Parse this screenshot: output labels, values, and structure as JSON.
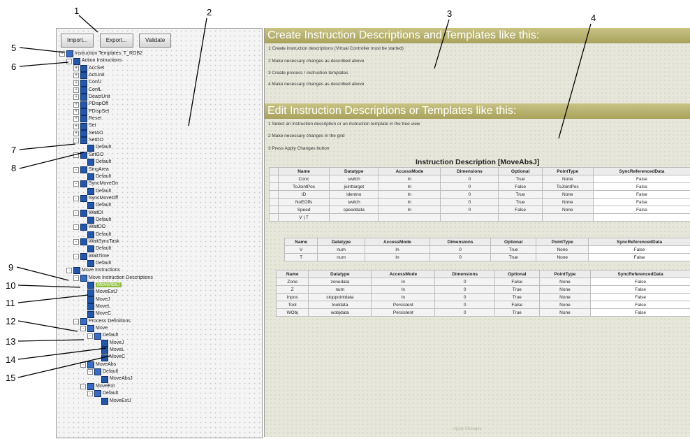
{
  "callouts": [
    "1",
    "2",
    "3",
    "4",
    "5",
    "6",
    "7",
    "8",
    "9",
    "10",
    "11",
    "12",
    "13",
    "14",
    "15"
  ],
  "toolbar": {
    "import_label": "Import...",
    "export_label": "Export...",
    "validate_label": "Validate"
  },
  "tree": [
    {
      "label": "Instruction Templates: T_ROB2",
      "indent": 0,
      "icon": "folder",
      "exp": "-"
    },
    {
      "label": "Action Instructions",
      "indent": 1,
      "icon": "group",
      "exp": "-"
    },
    {
      "label": "AccSet",
      "indent": 2,
      "icon": "instr",
      "exp": "+"
    },
    {
      "label": "ActUnit",
      "indent": 2,
      "icon": "instr",
      "exp": "+"
    },
    {
      "label": "ConfJ",
      "indent": 2,
      "icon": "instr",
      "exp": "+"
    },
    {
      "label": "ConfL",
      "indent": 2,
      "icon": "instr",
      "exp": "+"
    },
    {
      "label": "DeactUnit",
      "indent": 2,
      "icon": "instr",
      "exp": "+"
    },
    {
      "label": "PDispOff",
      "indent": 2,
      "icon": "instr",
      "exp": "+"
    },
    {
      "label": "PDispSet",
      "indent": 2,
      "icon": "instr",
      "exp": "+"
    },
    {
      "label": "Reset",
      "indent": 2,
      "icon": "instr",
      "exp": "+"
    },
    {
      "label": "Set",
      "indent": 2,
      "icon": "instr",
      "exp": "+"
    },
    {
      "label": "SetAO",
      "indent": 2,
      "icon": "instr",
      "exp": "+"
    },
    {
      "label": "SetDO",
      "indent": 2,
      "icon": "instr",
      "exp": "-"
    },
    {
      "label": "Default",
      "indent": 3,
      "icon": "instr",
      "exp": ""
    },
    {
      "label": "SetGO",
      "indent": 2,
      "icon": "instr",
      "exp": "-"
    },
    {
      "label": "Default",
      "indent": 3,
      "icon": "instr",
      "exp": ""
    },
    {
      "label": "SingArea",
      "indent": 2,
      "icon": "instr",
      "exp": "-"
    },
    {
      "label": "Default",
      "indent": 3,
      "icon": "instr",
      "exp": ""
    },
    {
      "label": "SyncMoveOn",
      "indent": 2,
      "icon": "instr",
      "exp": "-"
    },
    {
      "label": "Default",
      "indent": 3,
      "icon": "instr",
      "exp": ""
    },
    {
      "label": "SyncMoveOff",
      "indent": 2,
      "icon": "instr",
      "exp": "-"
    },
    {
      "label": "Default",
      "indent": 3,
      "icon": "instr",
      "exp": ""
    },
    {
      "label": "WaitDI",
      "indent": 2,
      "icon": "instr",
      "exp": "-"
    },
    {
      "label": "Default",
      "indent": 3,
      "icon": "instr",
      "exp": ""
    },
    {
      "label": "WaitDO",
      "indent": 2,
      "icon": "instr",
      "exp": "-"
    },
    {
      "label": "Default",
      "indent": 3,
      "icon": "instr",
      "exp": ""
    },
    {
      "label": "WaitSyncTask",
      "indent": 2,
      "icon": "instr",
      "exp": "-"
    },
    {
      "label": "Default",
      "indent": 3,
      "icon": "instr",
      "exp": ""
    },
    {
      "label": "WaitTime",
      "indent": 2,
      "icon": "instr",
      "exp": "-"
    },
    {
      "label": "Default",
      "indent": 3,
      "icon": "instr",
      "exp": ""
    },
    {
      "label": "Move Instructions",
      "indent": 1,
      "icon": "group",
      "exp": "-"
    },
    {
      "label": "Move Instruction Descriptions",
      "indent": 2,
      "icon": "folder",
      "exp": "-"
    },
    {
      "label": "MoveAbsJ",
      "indent": 3,
      "icon": "instr",
      "exp": "",
      "selected": true
    },
    {
      "label": "MoveExtJ",
      "indent": 3,
      "icon": "instr",
      "exp": ""
    },
    {
      "label": "MoveJ",
      "indent": 3,
      "icon": "instr",
      "exp": ""
    },
    {
      "label": "MoveL",
      "indent": 3,
      "icon": "instr",
      "exp": ""
    },
    {
      "label": "MoveC",
      "indent": 3,
      "icon": "instr",
      "exp": ""
    },
    {
      "label": "Process Definitions",
      "indent": 2,
      "icon": "folder",
      "exp": "-"
    },
    {
      "label": "Move",
      "indent": 3,
      "icon": "folder",
      "exp": "-"
    },
    {
      "label": "Default",
      "indent": 4,
      "icon": "folder",
      "exp": "-"
    },
    {
      "label": "MoveJ",
      "indent": 5,
      "icon": "instr",
      "exp": ""
    },
    {
      "label": "MoveL",
      "indent": 5,
      "icon": "instr",
      "exp": ""
    },
    {
      "label": "MoveC",
      "indent": 5,
      "icon": "instr",
      "exp": ""
    },
    {
      "label": "MoveAbs",
      "indent": 3,
      "icon": "folder",
      "exp": "-"
    },
    {
      "label": "Default",
      "indent": 4,
      "icon": "folder",
      "exp": "-"
    },
    {
      "label": "MoveAbsJ",
      "indent": 5,
      "icon": "instr",
      "exp": ""
    },
    {
      "label": "MoveExt",
      "indent": 3,
      "icon": "folder",
      "exp": "-"
    },
    {
      "label": "Default",
      "indent": 4,
      "icon": "folder",
      "exp": "-"
    },
    {
      "label": "MoveExtJ",
      "indent": 5,
      "icon": "instr",
      "exp": ""
    }
  ],
  "create_section": {
    "title": "Create Instruction Descriptions and Templates like this:",
    "steps": [
      "1 Create instruction descriptions (Virtual Controller must be started)",
      "2 Make necessary changes as described above",
      "3 Create process / instruction templates",
      "4 Make necessary changes as described above"
    ]
  },
  "edit_section": {
    "title": "Edit Instruction Descriptions or Templates like this:",
    "steps": [
      "1 Select an instruction description or an instruction template in the tree view",
      "2 Make necessary changes in the grid",
      "3 Press Apply Changes button"
    ]
  },
  "grid": {
    "title": "Instruction Description [MoveAbsJ]",
    "columns": [
      "Name",
      "Datatype",
      "AccessMode",
      "Dimensions",
      "Optional",
      "PointType",
      "SyncReferencedData"
    ],
    "main_rows": [
      [
        "Conc",
        "switch",
        "In",
        "0",
        "True",
        "None",
        "False"
      ],
      [
        "ToJointPos",
        "jointtarget",
        "In",
        "0",
        "False",
        "ToJointPos",
        "False"
      ],
      [
        "ID",
        "identno",
        "In",
        "0",
        "True",
        "None",
        "False"
      ],
      [
        "NoEOffs",
        "switch",
        "In",
        "0",
        "True",
        "None",
        "False"
      ],
      [
        "Speed",
        "speeddata",
        "In",
        "0",
        "False",
        "None",
        "False"
      ],
      [
        "V | T",
        "",
        "",
        "",
        "",
        "",
        ""
      ]
    ],
    "sub_rows": [
      [
        "V",
        "num",
        "In",
        "0",
        "True",
        "None",
        "False"
      ],
      [
        "T",
        "num",
        "In",
        "0",
        "True",
        "None",
        "False"
      ]
    ],
    "rest_rows": [
      [
        "Zone",
        "zonedata",
        "In",
        "0",
        "False",
        "None",
        "False"
      ],
      [
        "Z",
        "num",
        "In",
        "0",
        "True",
        "None",
        "False"
      ],
      [
        "Inpos",
        "stoppointdata",
        "In",
        "0",
        "True",
        "None",
        "False"
      ],
      [
        "Tool",
        "tooldata",
        "Persistent",
        "0",
        "False",
        "None",
        "False"
      ],
      [
        "WObj",
        "wobjdata",
        "Persistent",
        "0",
        "True",
        "None",
        "False"
      ]
    ]
  },
  "apply_button_label": "Apply Changes"
}
